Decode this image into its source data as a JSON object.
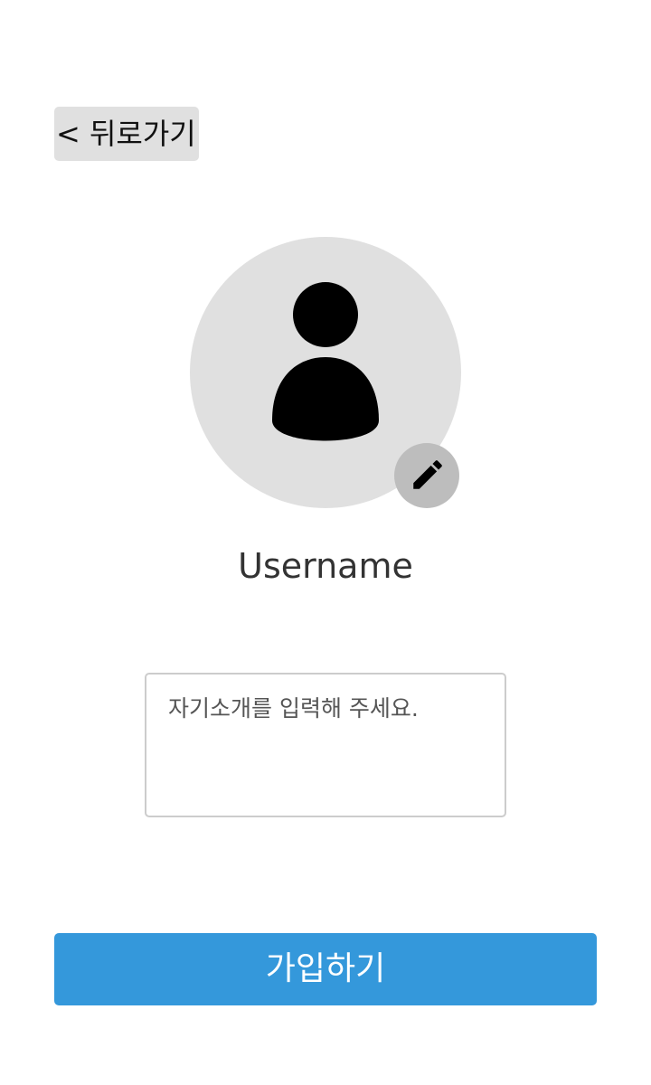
{
  "header": {
    "back_label": "< 뒤로가기"
  },
  "profile": {
    "avatar_icon": "person-icon",
    "edit_icon": "pencil-icon",
    "username": "Username"
  },
  "bio": {
    "value": "",
    "placeholder": "자기소개를 입력해 주세요."
  },
  "actions": {
    "signup_label": "가입하기"
  },
  "colors": {
    "background": "#ffffff",
    "back_button_bg": "#e0e0e0",
    "avatar_bg": "#e0e0e0",
    "edit_button_bg": "#bdbdbd",
    "input_border": "#cccccc",
    "primary": "#3498db",
    "primary_text": "#ffffff",
    "text": "#333333"
  }
}
